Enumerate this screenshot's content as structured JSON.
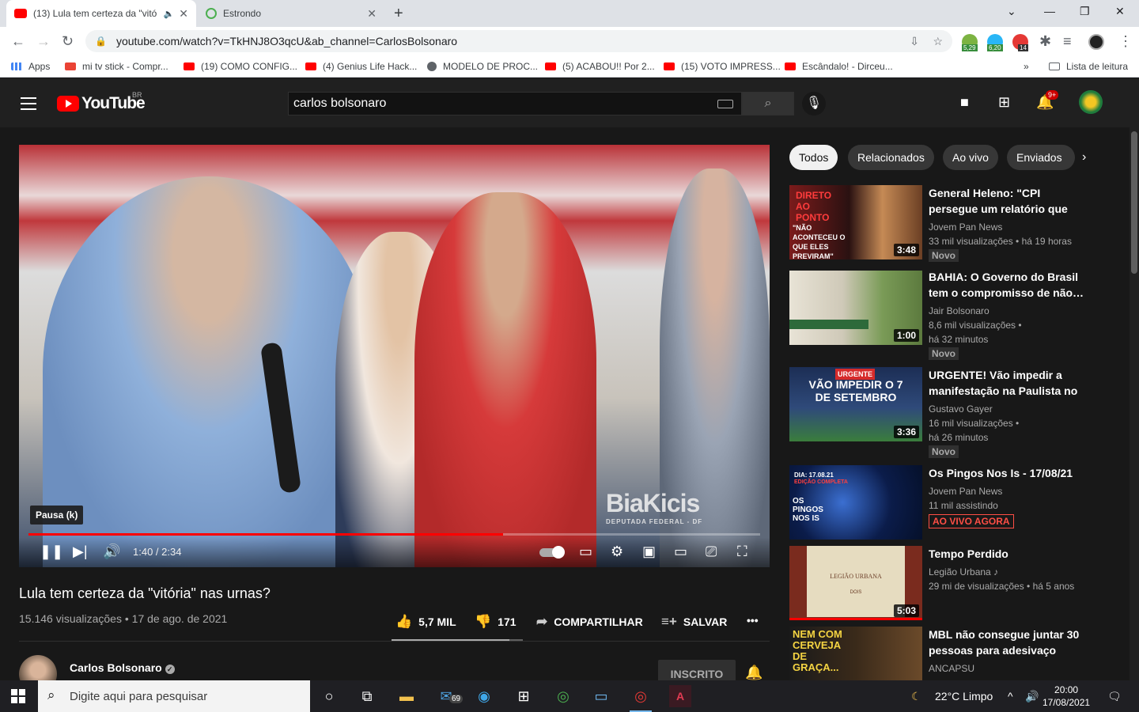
{
  "browser": {
    "tabs": [
      {
        "title": "(13) Lula tem certeza da \"vitó",
        "active": true
      },
      {
        "title": "Estrondo",
        "active": false
      }
    ],
    "url": "youtube.com/watch?v=TkHNJ8O3qcU&ab_channel=CarlosBolsonaro",
    "extensions": [
      {
        "badge": "5,29"
      },
      {
        "badge": "6,20"
      },
      {
        "badge": "14"
      }
    ],
    "bookmarks": [
      {
        "label": "Apps"
      },
      {
        "label": "mi tv stick - Compr..."
      },
      {
        "label": "(19) COMO CONFIG..."
      },
      {
        "label": "(4) Genius Life Hack..."
      },
      {
        "label": "MODELO DE PROC..."
      },
      {
        "label": "(5) ACABOU!! Por 2..."
      },
      {
        "label": "(15) VOTO IMPRESS..."
      },
      {
        "label": "Escândalo! - Dirceu..."
      }
    ],
    "reading_list": "Lista de leitura"
  },
  "youtube": {
    "logo_text": "YouTube",
    "region": "BR",
    "search_value": "carlos bolsonaro",
    "notif_badge": "9+"
  },
  "player": {
    "watermark": "BiaKicis",
    "watermark_sub": "DEPUTADA FEDERAL - DF",
    "tooltip": "Pausa (k)",
    "time": "1:40 / 2:34",
    "progress": 0.649
  },
  "video": {
    "title": "Lula tem certeza da \"vitória\" nas urnas?",
    "meta": "15.146 visualizações • 17 de ago. de 2021",
    "likes": "5,7 MIL",
    "dislikes": "171",
    "share": "COMPARTILHAR",
    "save": "SALVAR",
    "channel": "Carlos Bolsonaro",
    "subscribe": "INSCRITO"
  },
  "chips": [
    "Todos",
    "Relacionados",
    "Ao vivo",
    "Enviados"
  ],
  "recommendations": [
    {
      "title": "General Heleno: \"CPI persegue um relatório que está pronto\"",
      "channel": "Jovem Pan News",
      "views": "33 mil visualizações • há 19 horas",
      "badge": "Novo",
      "duration": "3:48",
      "thumb_text1": "DIRETO AO PONTO",
      "thumb_text2": "\"NÃO ACONTECEU O QUE ELES PREVIRAM\""
    },
    {
      "title": "BAHIA: O Governo do Brasil tem o compromisso de não…",
      "channel": "Jair Bolsonaro",
      "views": "8,6 mil visualizações •",
      "views2": "há 32 minutos",
      "badge": "Novo",
      "duration": "1:00"
    },
    {
      "title": "URGENTE! Vão impedir a manifestação na Paulista no …",
      "channel": "Gustavo Gayer",
      "views": "16 mil visualizações •",
      "views2": "há 26 minutos",
      "badge": "Novo",
      "duration": "3:36",
      "thumb_text1": "URGENTE",
      "thumb_text2": "VÃO IMPEDIR O 7 DE SETEMBRO"
    },
    {
      "title": "Os Pingos Nos Is - 17/08/21",
      "channel": "Jovem Pan News",
      "views": "11 mil assistindo",
      "badge": "AO VIVO AGORA",
      "thumb_text1": "DIA: 17.08.21",
      "thumb_text2": "EDIÇÃO COMPLETA",
      "thumb_text3": "OS PINGOS NOS IS"
    },
    {
      "title": "Tempo Perdido",
      "channel": "Legião Urbana ♪",
      "views": "29 mi de visualizações • há 5 anos",
      "duration": "5:03",
      "thumb_text1": "LEGIÃO URBANA",
      "thumb_text2": "DOIS"
    },
    {
      "title": "MBL não consegue juntar 30 pessoas para adesivaço",
      "channel": "ANCAPSU",
      "thumb_text1": "NEM COM CERVEJA DE GRAÇA..."
    }
  ],
  "taskbar": {
    "search_placeholder": "Digite aqui para pesquisar",
    "mail_badge": "69",
    "weather": "22°C  Limpo",
    "time": "20:00",
    "date": "17/08/2021"
  }
}
